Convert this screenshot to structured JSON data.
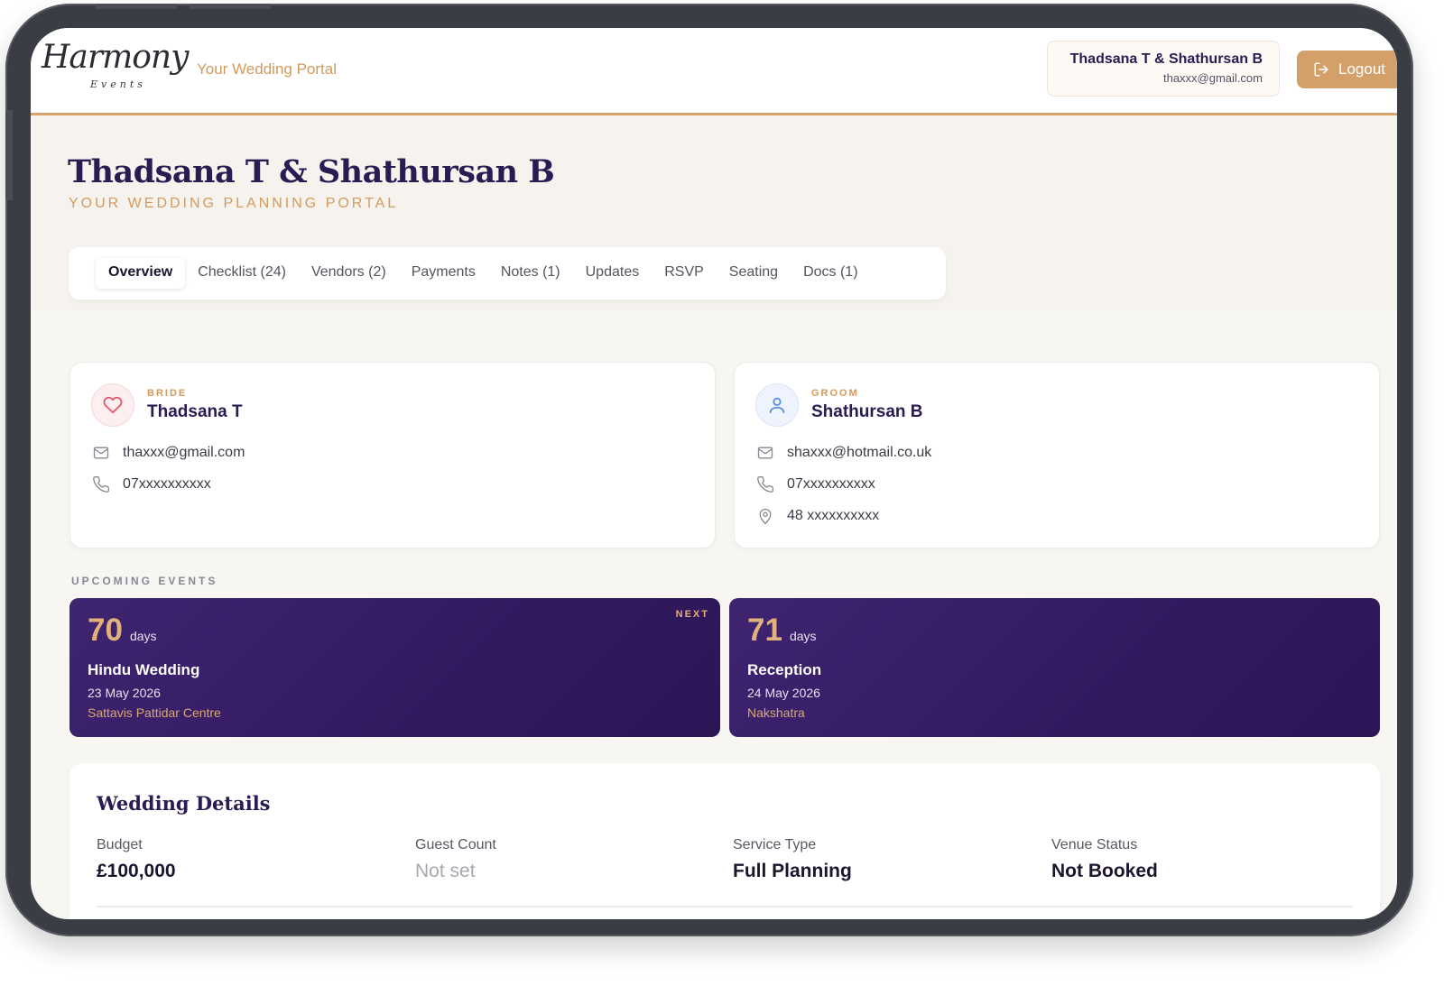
{
  "header": {
    "logo_text": "Harmony",
    "logo_sub": "Events",
    "portal_label": "Your Wedding Portal",
    "user_name": "Thadsana T & Shathursan B",
    "user_email": "thaxxx@gmail.com",
    "logout_label": "Logout"
  },
  "hero": {
    "title": "Thadsana T & Shathursan B",
    "subtitle": "YOUR WEDDING PLANNING PORTAL"
  },
  "tabs": [
    {
      "label": "Overview",
      "active": true
    },
    {
      "label": "Checklist (24)"
    },
    {
      "label": "Vendors (2)"
    },
    {
      "label": "Payments"
    },
    {
      "label": "Notes (1)"
    },
    {
      "label": "Updates"
    },
    {
      "label": "RSVP"
    },
    {
      "label": "Seating"
    },
    {
      "label": "Docs (1)"
    }
  ],
  "bride": {
    "role": "BRIDE",
    "name": "Thadsana T",
    "email": "thaxxx@gmail.com",
    "phone": "07xxxxxxxxxx",
    "icon": "heart-icon"
  },
  "groom": {
    "role": "GROOM",
    "name": "Shathursan B",
    "email": "shaxxx@hotmail.co.uk",
    "phone": "07xxxxxxxxxx",
    "address": "48 xxxxxxxxxx",
    "icon": "user-icon"
  },
  "upcoming": {
    "label": "UPCOMING EVENTS",
    "events": [
      {
        "days": "70",
        "unit": "days",
        "name": "Hindu Wedding",
        "date": "23 May 2026",
        "venue": "Sattavis Pattidar Centre",
        "badge": "NEXT"
      },
      {
        "days": "71",
        "unit": "days",
        "name": "Reception",
        "date": "24 May 2026",
        "venue": "Nakshatra"
      }
    ]
  },
  "details": {
    "title": "Wedding Details",
    "items": [
      {
        "label": "Budget",
        "value": "£100,000"
      },
      {
        "label": "Guest Count",
        "value": "Not set"
      },
      {
        "label": "Service Type",
        "value": "Full Planning"
      },
      {
        "label": "Venue Status",
        "value": "Not Booked"
      }
    ]
  },
  "colors": {
    "accent": "#d39a5b",
    "primary": "#2a1b52",
    "event_bg": "#3a1f68"
  }
}
